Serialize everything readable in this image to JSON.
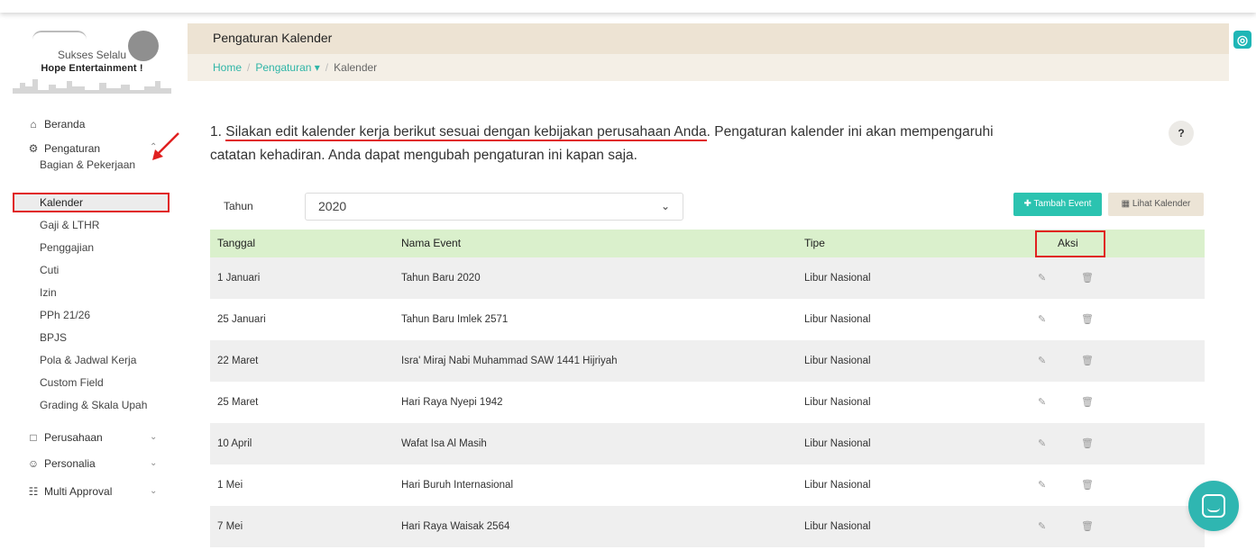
{
  "brand": {
    "line1": "Sukses Selalu",
    "line2": "Hope Entertainment !"
  },
  "sidebar": {
    "items": [
      {
        "label": "Beranda",
        "icon": "home-icon"
      },
      {
        "label": "Pengaturan",
        "icon": "cogs-icon"
      },
      {
        "label": "Perusahaan",
        "icon": "folder-icon"
      },
      {
        "label": "Personalia",
        "icon": "smile-icon"
      },
      {
        "label": "Multi Approval",
        "icon": "sitemap-icon"
      }
    ],
    "subitems": [
      "Bagian & Pekerjaan",
      "Kalender",
      "Gaji & LTHR",
      "Penggajian",
      "Cuti",
      "Izin",
      "PPh 21/26",
      "BPJS",
      "Pola & Jadwal Kerja",
      "Custom Field",
      "Grading & Skala Upah"
    ],
    "active_subitem": "Kalender"
  },
  "header": {
    "title": "Pengaturan Kalender",
    "breadcrumb": {
      "home": "Home",
      "sep": "/",
      "parent": "Pengaturan",
      "parent_caret": "▾",
      "current": "Kalender"
    }
  },
  "intro": {
    "prefix": "1. ",
    "highlight": "Silakan edit kalender kerja berikut sesuai dengan kebijakan perusahaan Anda",
    "rest": ". Pengaturan kalender ini akan mempengaruhi catatan kehadiran. Anda dapat mengubah pengaturan ini kapan saja."
  },
  "help_label": "?",
  "filter": {
    "label": "Tahun",
    "value": "2020"
  },
  "buttons": {
    "add_event": "✚ Tambah Event",
    "view_calendar": "▦ Lihat Kalender"
  },
  "table": {
    "headers": {
      "date": "Tanggal",
      "name": "Nama Event",
      "type": "Tipe",
      "action": "Aksi"
    },
    "rows": [
      {
        "date": "1 Januari",
        "name": "Tahun Baru 2020",
        "type": "Libur Nasional"
      },
      {
        "date": "25 Januari",
        "name": "Tahun Baru Imlek 2571",
        "type": "Libur Nasional"
      },
      {
        "date": "22 Maret",
        "name": "Isra' Miraj Nabi Muhammad SAW 1441 Hijriyah",
        "type": "Libur Nasional"
      },
      {
        "date": "25 Maret",
        "name": "Hari Raya Nyepi 1942",
        "type": "Libur Nasional"
      },
      {
        "date": "10 April",
        "name": "Wafat Isa Al Masih",
        "type": "Libur Nasional"
      },
      {
        "date": "1 Mei",
        "name": "Hari Buruh Internasional",
        "type": "Libur Nasional"
      },
      {
        "date": "7 Mei",
        "name": "Hari Raya Waisak 2564",
        "type": "Libur Nasional"
      }
    ]
  },
  "icons": {
    "edit": "✎",
    "delete": "🗑"
  },
  "colors": {
    "accent": "#2bc3b0",
    "table_header": "#daf0cc",
    "highlight_red": "#e02020",
    "header_band": "#ede3d3"
  }
}
